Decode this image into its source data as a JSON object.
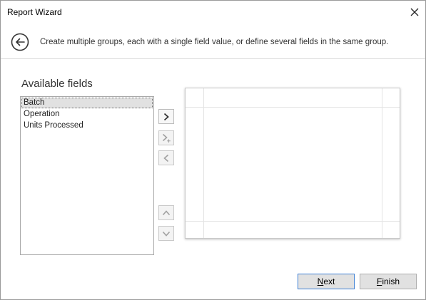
{
  "window": {
    "title": "Report Wizard"
  },
  "header": {
    "instruction": "Create multiple groups, each with a single field value, or define several fields in the same group."
  },
  "available_fields": {
    "title": "Available fields",
    "items": [
      {
        "label": "Batch",
        "selected": true
      },
      {
        "label": "Operation",
        "selected": false
      },
      {
        "label": "Units Processed",
        "selected": false
      }
    ]
  },
  "buttons": {
    "next_mnemonic": "N",
    "next_rest": "ext",
    "finish_mnemonic": "F",
    "finish_rest": "inish"
  },
  "icons": {
    "close": "close-icon",
    "back": "back-arrow-circle-icon",
    "add_group": "chevron-right-icon",
    "add_to_group": "chevron-right-plus-icon",
    "remove": "chevron-left-icon",
    "move_up": "chevron-up-icon",
    "move_down": "chevron-down-icon"
  },
  "colors": {
    "default_button_border": "#3c7fd4",
    "selection_background": "#e1e1e1"
  }
}
